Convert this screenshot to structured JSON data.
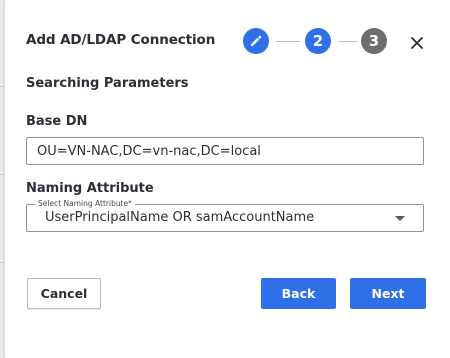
{
  "dialog": {
    "title": "Add AD/LDAP Connection",
    "close_icon": "close-icon"
  },
  "stepper": {
    "steps": [
      {
        "label": "",
        "icon": "pencil-icon",
        "state": "completed"
      },
      {
        "label": "2",
        "state": "current"
      },
      {
        "label": "3",
        "state": "pending"
      }
    ]
  },
  "section": {
    "title": "Searching Parameters"
  },
  "base_dn": {
    "label": "Base DN",
    "value": "OU=VN-NAC,DC=vn-nac,DC=local"
  },
  "naming_attribute": {
    "label": "Naming Attribute",
    "select_label": "Select Naming Attribute*",
    "selected": "UserPrincipalName OR samAccountName"
  },
  "buttons": {
    "cancel": "Cancel",
    "back": "Back",
    "next": "Next"
  },
  "colors": {
    "primary": "#2f6fe8",
    "step_inactive": "#6d6d6d",
    "text": "#2b2f36"
  }
}
